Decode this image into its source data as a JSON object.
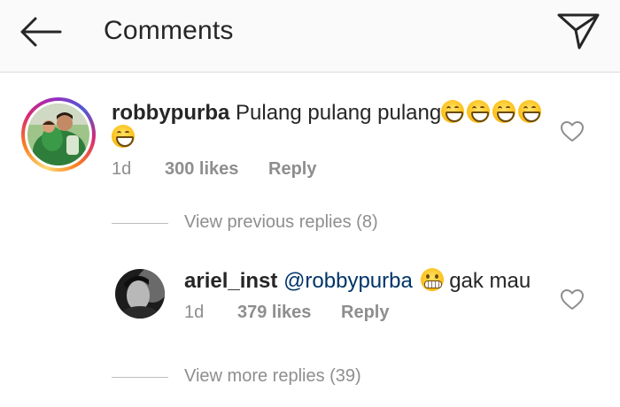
{
  "header": {
    "title": "Comments",
    "back_icon": "back-arrow-icon",
    "share_icon": "direct-send-icon"
  },
  "comments": [
    {
      "username": "robbypurba",
      "text": "Pulang pulang pulang",
      "emoji": [
        "grinning-face",
        "grinning-face",
        "grinning-face",
        "grinning-face",
        "grinning-face"
      ],
      "time": "1d",
      "likes": "300 likes",
      "reply_label": "Reply"
    }
  ],
  "previous_replies": "View previous replies (8)",
  "reply": {
    "username": "ariel_inst",
    "mention": "@robbypurba",
    "emoji": "grimacing-face",
    "text": "gak mau",
    "time": "1d",
    "likes": "379 likes",
    "reply_label": "Reply"
  },
  "more_replies": "View more replies (39)",
  "colors": {
    "text": "#262626",
    "secondary": "#8e8e8e",
    "mention": "#003569",
    "header_bg": "#fafafa"
  }
}
